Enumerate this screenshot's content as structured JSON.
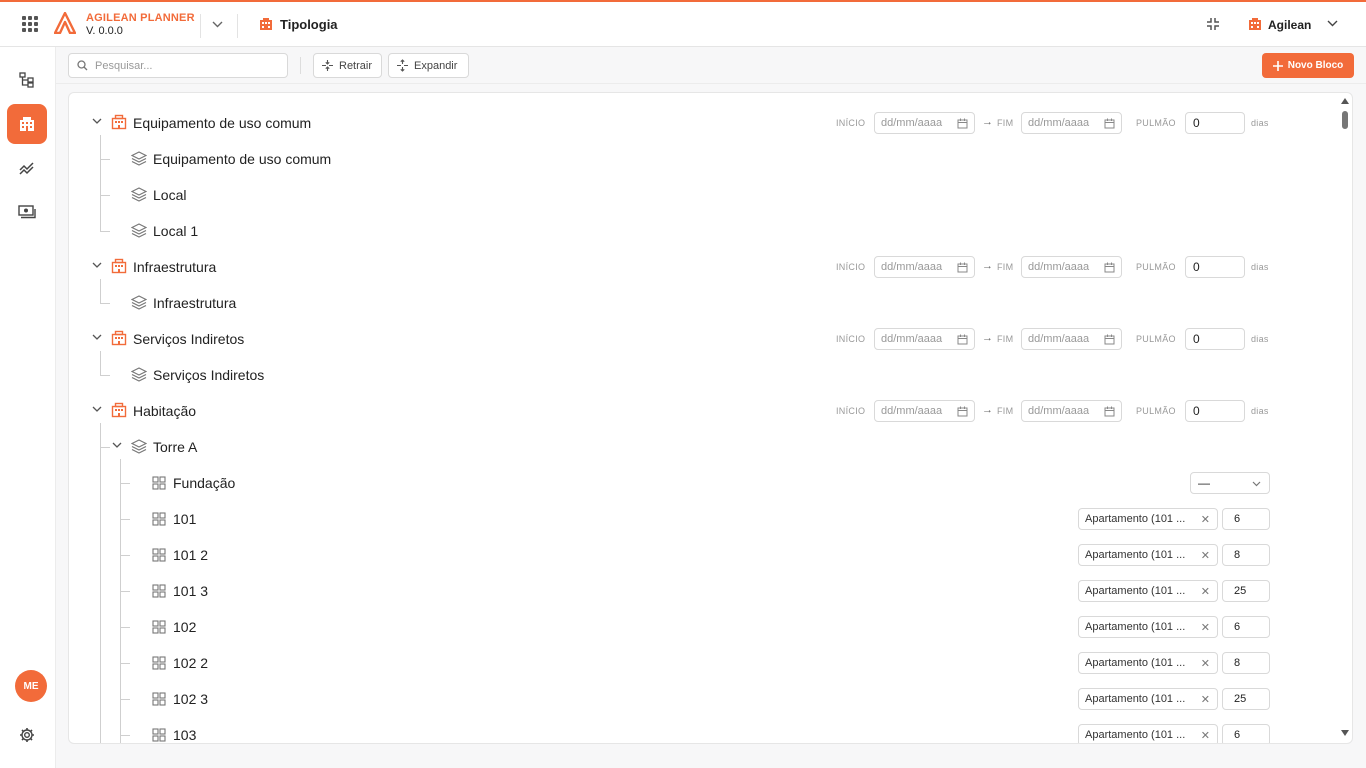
{
  "header": {
    "brand": "AGILEAN PLANNER",
    "version": "V. 0.0.0",
    "page_title": "Tipologia",
    "user_name": "Agilean"
  },
  "sidebar": {
    "avatar_initials": "ME",
    "items": [
      {
        "icon": "hierarchy-icon",
        "active": false
      },
      {
        "icon": "building-icon",
        "active": true
      },
      {
        "icon": "chart-icon",
        "active": false
      },
      {
        "icon": "money-icon",
        "active": false
      }
    ]
  },
  "toolbar": {
    "search_placeholder": "Pesquisar...",
    "collapse_label": "Retrair",
    "expand_label": "Expandir",
    "new_block_label": "Novo Bloco"
  },
  "date_labels": {
    "start": "INÍCIO",
    "end": "FIM",
    "buffer": "PULMÃO",
    "days": "dias",
    "date_placeholder": "dd/mm/aaaa",
    "arrow": "→"
  },
  "blocks": [
    {
      "name": "Equipamento de uso comum",
      "buffer": "0",
      "children": [
        "Equipamento de uso comum",
        "Local",
        "Local 1"
      ]
    },
    {
      "name": "Infraestrutura",
      "buffer": "0",
      "children": [
        "Infraestrutura"
      ]
    },
    {
      "name": "Serviços Indiretos",
      "buffer": "0",
      "children": [
        "Serviços Indiretos"
      ]
    },
    {
      "name": "Habitação",
      "buffer": "0",
      "children": [
        "Torre A"
      ]
    }
  ],
  "tower": {
    "name": "Torre A",
    "units": [
      {
        "name": "Fundação",
        "select": "—"
      },
      {
        "name": "101",
        "type": "Apartamento (101 ...",
        "qty": "6"
      },
      {
        "name": "101 2",
        "type": "Apartamento (101 ...",
        "qty": "8"
      },
      {
        "name": "101 3",
        "type": "Apartamento (101 ...",
        "qty": "25"
      },
      {
        "name": "102",
        "type": "Apartamento (101 ...",
        "qty": "6"
      },
      {
        "name": "102 2",
        "type": "Apartamento (101 ...",
        "qty": "8"
      },
      {
        "name": "102 3",
        "type": "Apartamento (101 ...",
        "qty": "25"
      },
      {
        "name": "103",
        "type": "Apartamento (101 ...",
        "qty": "6"
      }
    ]
  },
  "colors": {
    "accent": "#f26b3a"
  }
}
